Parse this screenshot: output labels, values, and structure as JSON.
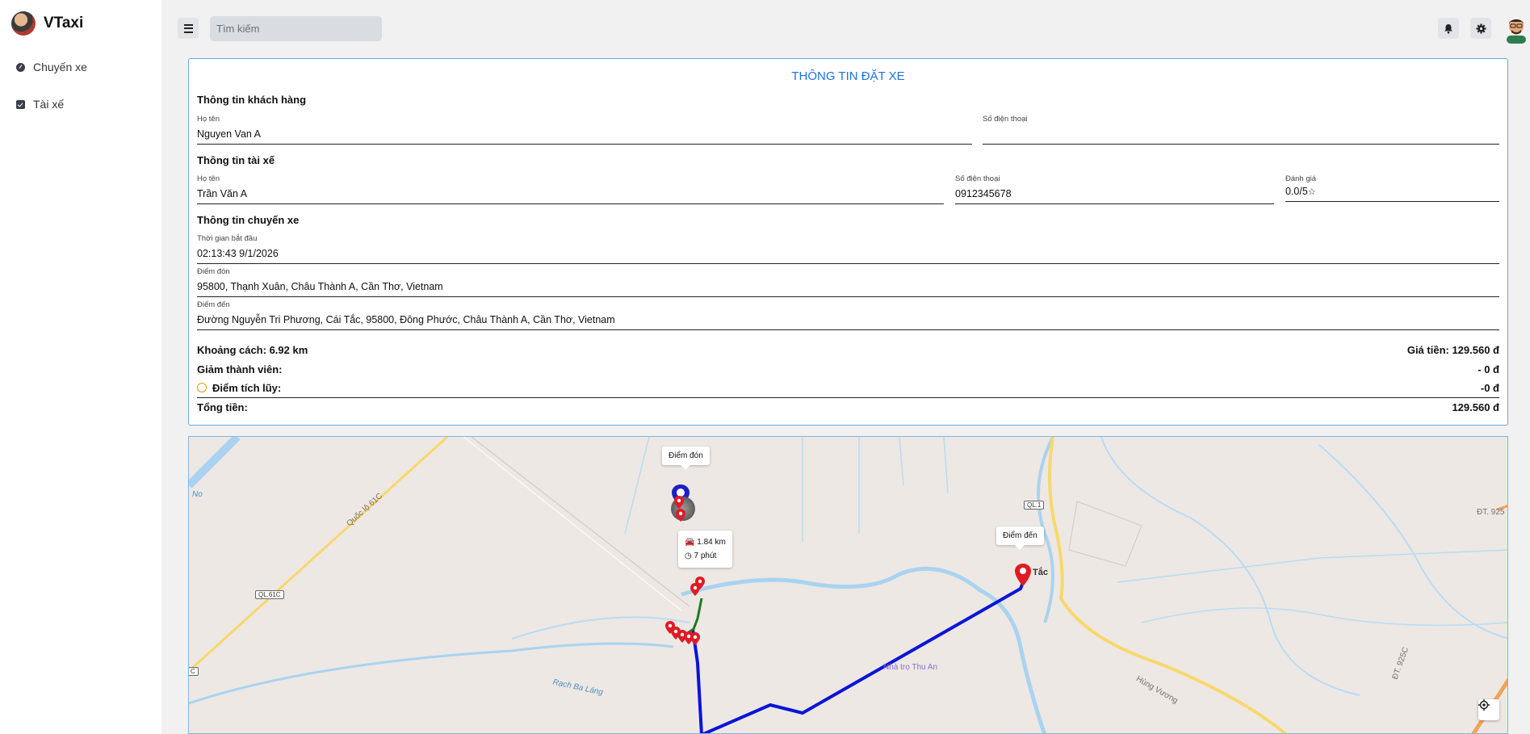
{
  "app": {
    "name": "VTaxi"
  },
  "sidebar": {
    "items": [
      {
        "label": "Chuyến xe",
        "icon": "dashboard-icon"
      },
      {
        "label": "Tài xế",
        "icon": "check-square-icon"
      }
    ]
  },
  "header": {
    "search_placeholder": "Tìm kiếm",
    "icons": [
      "menu-icon",
      "bell-icon",
      "gear-icon",
      "avatar"
    ]
  },
  "booking": {
    "title": "THÔNG TIN ĐẶT XE",
    "customer": {
      "section": "Thông tin khách hàng",
      "name_label": "Họ tên",
      "name": "Nguyen Van A",
      "phone_label": "Số điện thoại",
      "phone": ""
    },
    "driver": {
      "section": "Thông tin tài xế",
      "name_label": "Họ tên",
      "name": "Trần Văn A",
      "phone_label": "Số điện thoại",
      "phone": "0912345678",
      "rating_label": "Đánh giá",
      "rating": "0.0/5"
    },
    "trip": {
      "section": "Thông tin chuyến xe",
      "start_label": "Thời gian bắt đầu",
      "start": "02:13:43 9/1/2026",
      "pickup_label": "Điểm đón",
      "pickup": "95800, Thạnh Xuân, Châu Thành A, Cần Thơ, Vietnam",
      "dropoff_label": "Điểm đến",
      "dropoff": "Đường Nguyễn Tri Phương, Cái Tắc, 95800, Đông Phước, Châu Thành A, Cần Thơ, Vietnam"
    },
    "summary": {
      "distance": "Khoảng cách: 6.92 km",
      "price": "Giá tiền: 129.560 đ",
      "member_discount_label": "Giảm thành viên:",
      "member_discount": "- 0 đ",
      "points_label": "Điểm tích lũy:",
      "points": "-0 đ",
      "total_label": "Tổng tiền:",
      "total": "129.560 đ"
    }
  },
  "map": {
    "pickup_popup": "Điểm đón",
    "dropoff_popup": "Điểm đến",
    "driver_distance": "1.84 km",
    "driver_time": "7 phút",
    "labels": {
      "road_61c": "Quốc lộ 61C",
      "shield_ql61c": "QL.61C",
      "shield_ql1": "QL.1",
      "dt925": "ĐT. 925",
      "dt925c": "ĐT. 925C",
      "hung_vuong": "Hùng Vương",
      "rach_ba_lang": "Rạch Ba Láng",
      "nha_tro": "Nhà trọ Thu An",
      "tac": "Tắc",
      "no": "No",
      "shield_c": "C"
    },
    "colors": {
      "route": "#0a14d8",
      "driver_path": "#1f7a1f",
      "marker": "#e01b24",
      "pickup_marker": "#1d20c8"
    }
  }
}
